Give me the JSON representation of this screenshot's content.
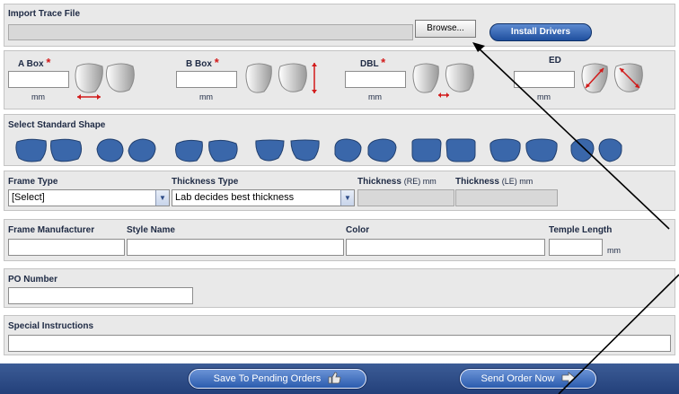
{
  "import": {
    "title": "Import Trace File",
    "browse_label": "Browse...",
    "install_label": "Install Drivers"
  },
  "measurements": {
    "a_box": {
      "label": "A Box",
      "required": "*",
      "unit": "mm"
    },
    "b_box": {
      "label": "B Box",
      "required": "*",
      "unit": "mm"
    },
    "dbl": {
      "label": "DBL",
      "required": "*",
      "unit": "mm"
    },
    "ed": {
      "label": "ED",
      "unit": "mm"
    }
  },
  "shapes": {
    "title": "Select Standard Shape",
    "icons": [
      "shape-1-icon",
      "shape-2-icon",
      "shape-3-icon",
      "shape-4-icon",
      "shape-5-icon",
      "shape-6-icon",
      "shape-7-icon",
      "shape-8-icon"
    ]
  },
  "frame": {
    "frame_type_label": "Frame Type",
    "frame_type_value": "[Select]",
    "thickness_type_label": "Thickness Type",
    "thickness_type_value": "Lab decides best thickness",
    "thickness_re_label": "Thickness",
    "thickness_re_sub": "(RE) mm",
    "thickness_le_label": "Thickness",
    "thickness_le_sub": "(LE) mm"
  },
  "details": {
    "manufacturer_label": "Frame Manufacturer",
    "style_label": "Style Name",
    "color_label": "Color",
    "temple_label": "Temple Length",
    "temple_unit": "mm"
  },
  "po": {
    "label": "PO Number"
  },
  "instructions": {
    "label": "Special Instructions"
  },
  "actions": {
    "save_label": "Save To Pending Orders",
    "send_label": "Send Order Now"
  },
  "colors": {
    "panel_bg": "#e9e9e9",
    "lens_fill": "#3a67aa",
    "pill_blue": "#1f4f9e",
    "bar_blue": "#2f4e89",
    "required_red": "#d21a1a"
  }
}
